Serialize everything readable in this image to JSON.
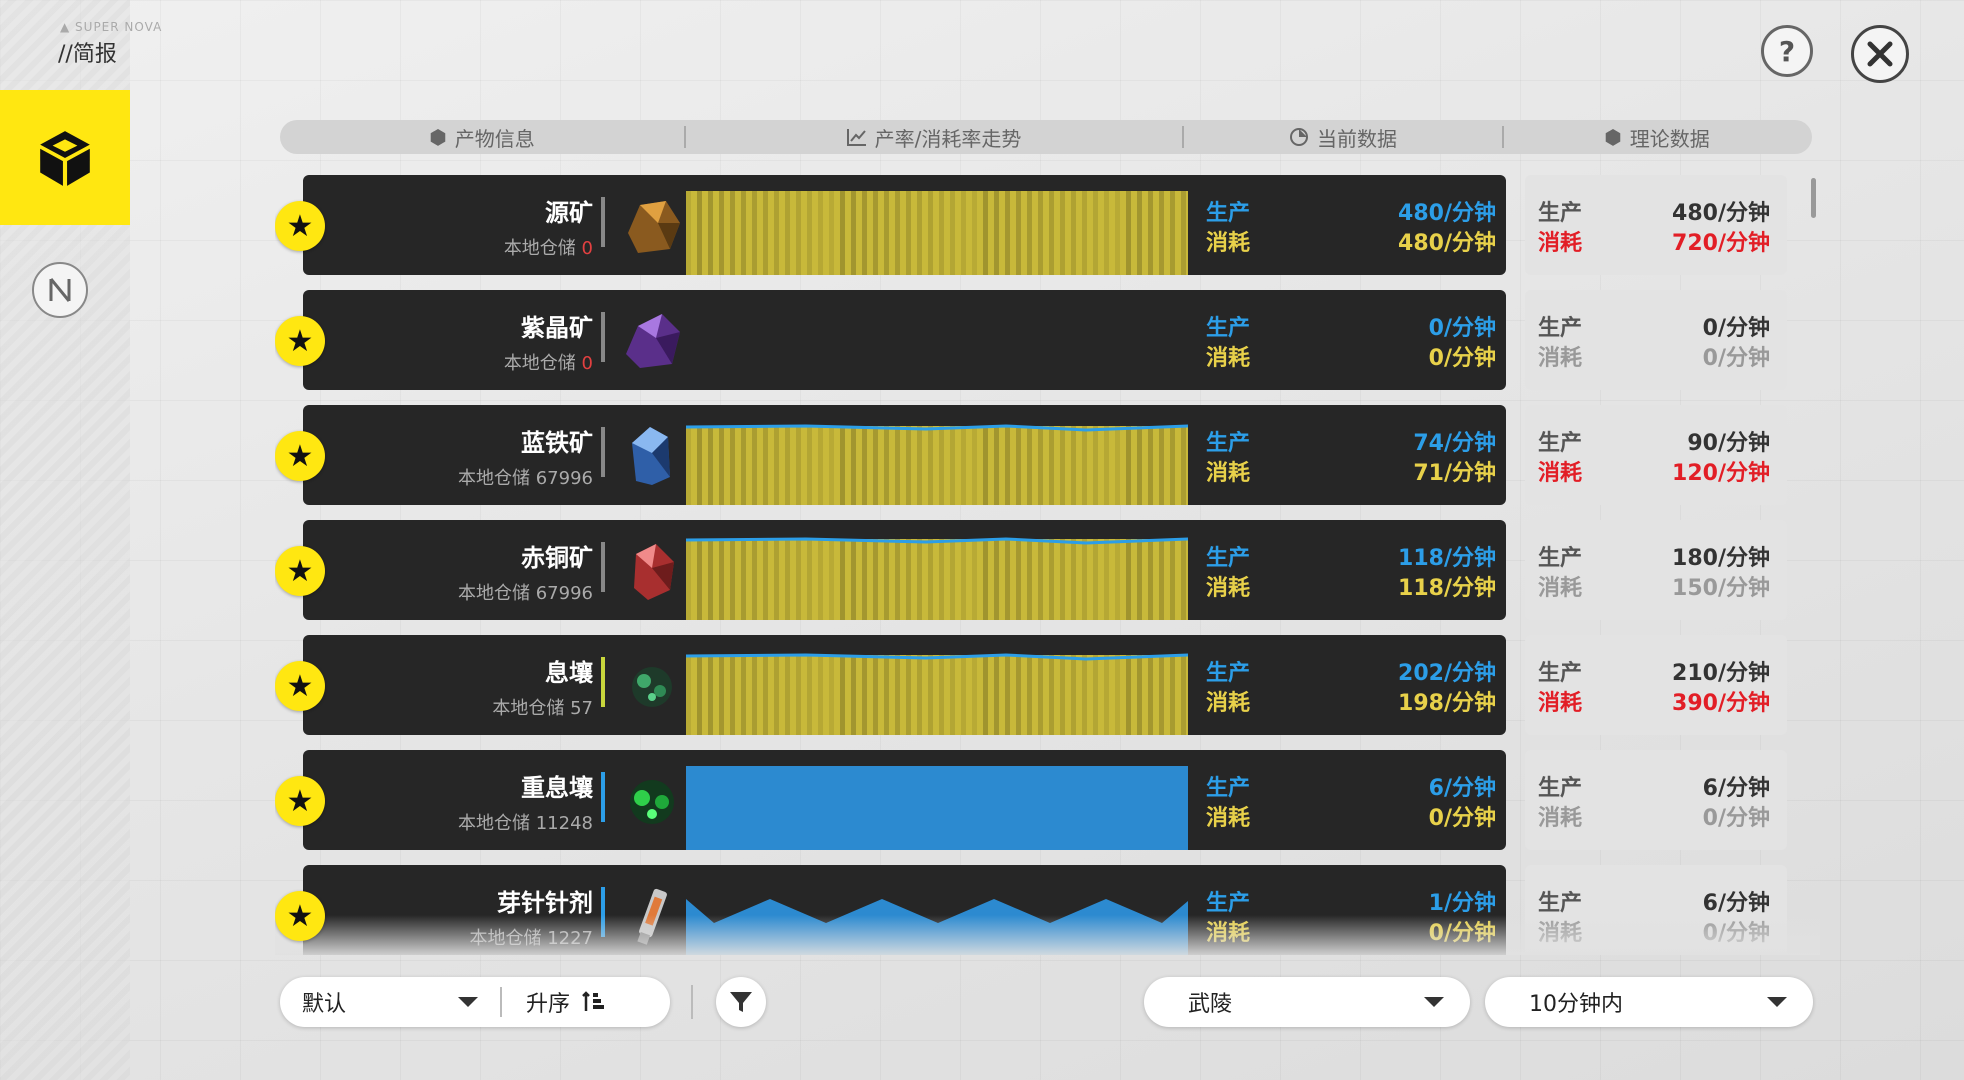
{
  "page": {
    "title": "//简报",
    "brand_text": "▲ SUPER NOVA"
  },
  "header": {
    "columns": [
      "产物信息",
      "产率/消耗率走势",
      "当前数据",
      "理论数据"
    ]
  },
  "rows": [
    {
      "name": "源矿",
      "stock_label": "本地仓储",
      "stock": "0",
      "stock_zero": true,
      "accent": "#888888",
      "icon": "origin-ore-icon",
      "current": {
        "prod_label": "生产",
        "cons_label": "消耗",
        "prod": "480/分钟",
        "cons": "480/分钟"
      },
      "theory": {
        "prod_label": "生产",
        "cons_label": "消耗",
        "prod": "480/分钟",
        "cons": "720/分钟",
        "cons_red": true,
        "dim": false
      }
    },
    {
      "name": "紫晶矿",
      "stock_label": "本地仓储",
      "stock": "0",
      "stock_zero": true,
      "accent": "#888888",
      "icon": "amethyst-ore-icon",
      "current": {
        "prod_label": "生产",
        "cons_label": "消耗",
        "prod": "0/分钟",
        "cons": "0/分钟"
      },
      "theory": {
        "prod_label": "生产",
        "cons_label": "消耗",
        "prod": "0/分钟",
        "cons": "0/分钟",
        "cons_red": false,
        "dim": true
      }
    },
    {
      "name": "蓝铁矿",
      "stock_label": "本地仓储",
      "stock": "67996",
      "stock_zero": false,
      "accent": "#888888",
      "icon": "blue-iron-ore-icon",
      "current": {
        "prod_label": "生产",
        "cons_label": "消耗",
        "prod": "74/分钟",
        "cons": "71/分钟"
      },
      "theory": {
        "prod_label": "生产",
        "cons_label": "消耗",
        "prod": "90/分钟",
        "cons": "120/分钟",
        "cons_red": true,
        "dim": false
      }
    },
    {
      "name": "赤铜矿",
      "stock_label": "本地仓储",
      "stock": "67996",
      "stock_zero": false,
      "accent": "#888888",
      "icon": "red-copper-ore-icon",
      "current": {
        "prod_label": "生产",
        "cons_label": "消耗",
        "prod": "118/分钟",
        "cons": "118/分钟"
      },
      "theory": {
        "prod_label": "生产",
        "cons_label": "消耗",
        "prod": "180/分钟",
        "cons": "150/分钟",
        "cons_red": false,
        "dim": true
      }
    },
    {
      "name": "息壤",
      "stock_label": "本地仓储",
      "stock": "57",
      "stock_zero": false,
      "accent": "#c8d63c",
      "icon": "xirang-icon",
      "current": {
        "prod_label": "生产",
        "cons_label": "消耗",
        "prod": "202/分钟",
        "cons": "198/分钟"
      },
      "theory": {
        "prod_label": "生产",
        "cons_label": "消耗",
        "prod": "210/分钟",
        "cons": "390/分钟",
        "cons_red": true,
        "dim": false
      }
    },
    {
      "name": "重息壤",
      "stock_label": "本地仓储",
      "stock": "11248",
      "stock_zero": false,
      "accent": "#2c9ee8",
      "icon": "heavy-xirang-icon",
      "current": {
        "prod_label": "生产",
        "cons_label": "消耗",
        "prod": "6/分钟",
        "cons": "0/分钟"
      },
      "theory": {
        "prod_label": "生产",
        "cons_label": "消耗",
        "prod": "6/分钟",
        "cons": "0/分钟",
        "cons_red": false,
        "dim": true
      }
    },
    {
      "name": "芽针针剂",
      "stock_label": "本地仓储",
      "stock": "1227",
      "stock_zero": false,
      "accent": "#2c9ee8",
      "icon": "bud-needle-injection-icon",
      "current": {
        "prod_label": "生产",
        "cons_label": "消耗",
        "prod": "1/分钟",
        "cons": "0/分钟"
      },
      "theory": {
        "prod_label": "生产",
        "cons_label": "消耗",
        "prod": "6/分钟",
        "cons": "0/分钟",
        "cons_red": false,
        "dim": true
      }
    }
  ],
  "bottom": {
    "sort_label": "默认",
    "order_label": "升序",
    "region_label": "武陵",
    "range_label": "10分钟内"
  },
  "colors": {
    "yellow": "#ffe711",
    "prod_blue": "#2c9ee8",
    "cons_yellow": "#e8d14a",
    "red": "#e21e26"
  }
}
